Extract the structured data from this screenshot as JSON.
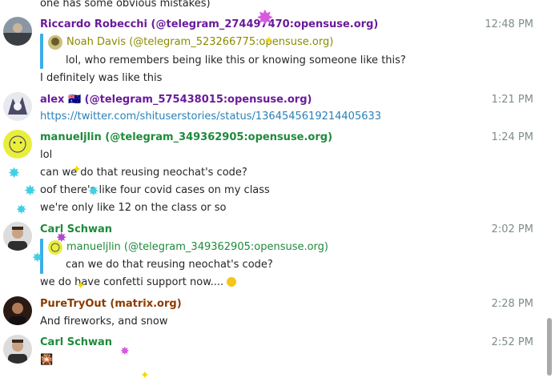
{
  "messages": {
    "m0": {
      "text": "one has some obvious mistakes)"
    },
    "m1": {
      "author": "Riccardo Robecchi (@telegram_274497470:opensuse.org)",
      "time": "12:48 PM",
      "reply_author": "Noah Davis (@telegram_523266775:opensuse.org)",
      "reply_text": "lol, who remembers being like this or knowing someone like this?",
      "text": "I definitely was like this"
    },
    "m2": {
      "author": "alex 🇦🇺 (@telegram_575438015:opensuse.org)",
      "time": "1:21 PM",
      "link": "https://twitter.com/shituserstories/status/1364545619214405633"
    },
    "m3": {
      "author": "manueljlin (@telegram_349362905:opensuse.org)",
      "time": "1:24 PM",
      "lines": [
        "lol",
        "can we do that reusing neochat's code?",
        "oof there's like four covid cases on my class",
        "we're only like 12 on the class or so"
      ]
    },
    "m4": {
      "author": "Carl Schwan",
      "time": "2:02 PM",
      "reply_author": "manueljlin (@telegram_349362905:opensuse.org)",
      "reply_text": "can we do that reusing neochat's code?",
      "text": "we do have confetti support now...."
    },
    "m5": {
      "author": "PureTryOut (matrix.org)",
      "time": "2:28 PM",
      "text": "And fireworks, and snow"
    },
    "m6": {
      "author": "Carl Schwan",
      "time": "2:52 PM",
      "text": "🎇"
    }
  },
  "colors": {
    "riccardo": "#6a1b9a",
    "noah": "#8b8b00",
    "alex": "#6a1b9a",
    "manuel": "#1e8a3c",
    "carl": "#1e8a3c",
    "pure": "#8b3a00",
    "link": "#2980b9",
    "quote_bar": "#3daee9",
    "time": "#7f8c8d"
  },
  "icons": {
    "smile_emoji": "thinking-face-icon",
    "fireworks_emoji": "sparkler-icon"
  }
}
